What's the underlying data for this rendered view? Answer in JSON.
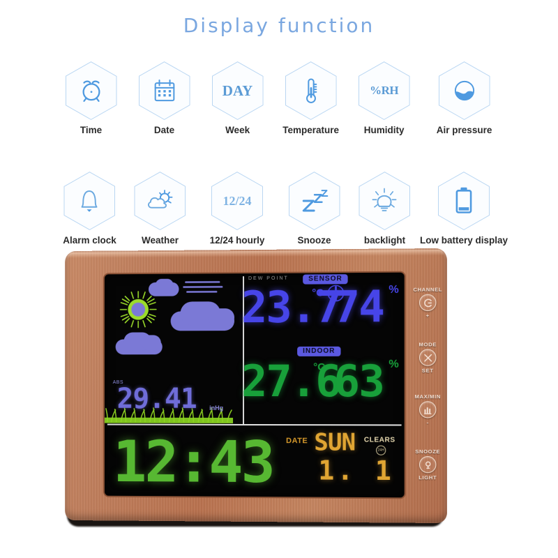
{
  "header": {
    "title": "Display function"
  },
  "features": {
    "row1": [
      {
        "label": "Time",
        "icon": "alarm-clock-icon"
      },
      {
        "label": "Date",
        "icon": "calendar-icon"
      },
      {
        "label": "Week",
        "icon": "day-text-icon",
        "glyph": "DAY"
      },
      {
        "label": "Temperature",
        "icon": "thermometer-icon"
      },
      {
        "label": "Humidity",
        "icon": "percent-rh-icon",
        "glyph": "%RH"
      },
      {
        "label": "Air pressure",
        "icon": "barometer-icon"
      }
    ],
    "row2": [
      {
        "label": "Alarm clock",
        "icon": "bell-icon"
      },
      {
        "label": "Weather",
        "icon": "sun-cloud-icon"
      },
      {
        "label": "12/24 hourly",
        "icon": "twelve-twentyfour-icon",
        "glyph": "12/24"
      },
      {
        "label": "Snooze",
        "icon": "zzz-icon"
      },
      {
        "label": "backlight",
        "icon": "lightbulb-icon"
      },
      {
        "label": "Low battery display",
        "icon": "battery-icon"
      }
    ]
  },
  "device": {
    "screen": {
      "weather_panel": {
        "condition_icon": "sun-behind-clouds-icon",
        "grass_icon": "grass-icon"
      },
      "barometer": {
        "mode_label": "ABS",
        "value": "29.41",
        "unit": "inHg"
      },
      "outdoor": {
        "section_label": "DEW POINT",
        "badge": "SENSOR",
        "temperature": "23.7",
        "temp_unit": "°C",
        "humidity": "74",
        "humidity_unit": "%",
        "rf_icon": "rf-signal-icon"
      },
      "indoor": {
        "badge": "INDOOR",
        "temperature": "27.6",
        "temp_unit": "°C",
        "humidity": "63",
        "humidity_unit": "%"
      },
      "clock": {
        "time": "12:43",
        "date_label": "DATE",
        "weekday": "SUN",
        "date_value": "1. 1",
        "clear_label": "CLEARS",
        "clear_sub": "24H"
      }
    },
    "buttons": [
      {
        "top_label": "CHANNEL",
        "icon": "channel-icon",
        "bottom_label": "+"
      },
      {
        "top_label": "MODE",
        "icon": "mode-set-icon",
        "bottom_label": "SET"
      },
      {
        "top_label": "MAX/MIN",
        "icon": "max-min-icon",
        "bottom_label": "-"
      },
      {
        "top_label": "SNOOZE",
        "icon": "snooze-light-icon",
        "bottom_label": "LIGHT"
      }
    ]
  },
  "colors": {
    "title": "#7aa7e0",
    "icon_blue": "#5b9bd5",
    "hex_outline": "#b9d6f2",
    "lcd_blue": "#4745e8",
    "lcd_green": "#18a03a",
    "lcd_clock_green": "#57b832",
    "lcd_amber": "#e0a533",
    "wood": "#b9724f"
  }
}
